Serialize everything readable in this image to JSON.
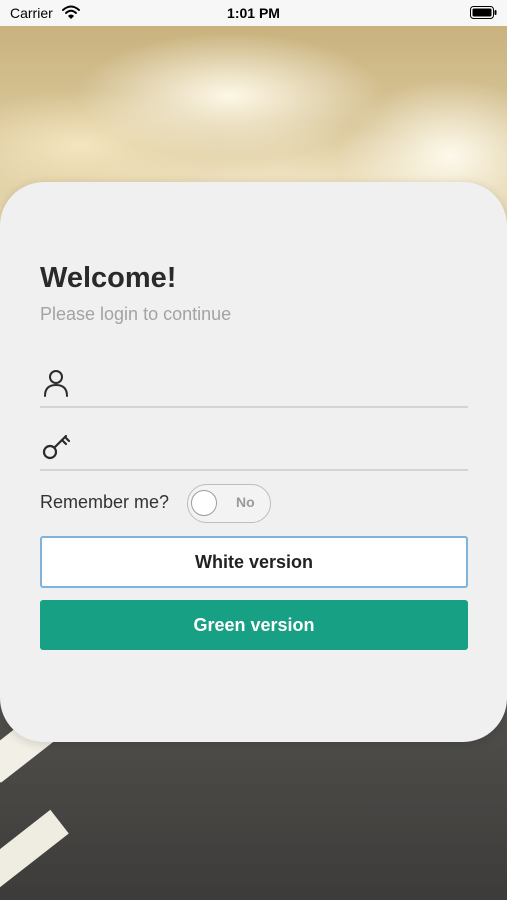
{
  "status_bar": {
    "carrier": "Carrier",
    "time": "1:01 PM"
  },
  "login": {
    "title": "Welcome!",
    "subtitle": "Please login to continue",
    "username": {
      "value": "",
      "placeholder": "",
      "icon": "user-icon"
    },
    "password": {
      "value": "",
      "placeholder": "",
      "icon": "key-icon"
    },
    "remember_label": "Remember me?",
    "remember_toggle": {
      "state_label": "No",
      "checked": false
    },
    "white_button_label": "White version",
    "green_button_label": "Green version"
  },
  "colors": {
    "accent_green": "#17a084",
    "white_button_border": "#7fb3d9",
    "card_background": "#f0f0f0"
  }
}
